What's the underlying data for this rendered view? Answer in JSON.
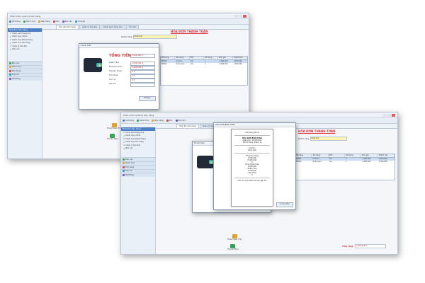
{
  "window1": {
    "title": "Phần mềm quản lý bán hàng",
    "menu": [
      "Hệ thống",
      "Danh mục",
      "Bán hàng",
      "Kho",
      "Báo cáo",
      "Trợ giúp"
    ],
    "tabs": [
      "Hóa đơn bán hàng",
      "Quản lý hóa đơn",
      "Danh sách hàng hóa",
      "Tồn kho"
    ],
    "sidebar_title": "Hóa đơn bán hàng",
    "sidebar_items": [
      "Danh sách hàng hóa",
      "Danh mục nhóm",
      "Danh mục khách hàng",
      "Danh mục kho hàng",
      "Quản lý hóa đơn",
      "Báo cáo"
    ],
    "sidebar_groups": [
      "Báo cáo",
      "Danh mục",
      "Kho hàng",
      "Tiện ích",
      "Hệ thống"
    ],
    "invoice_title": "HÓA ĐƠN THANH TOÁN",
    "customer_label": "Khách hàng",
    "customer_value": "Khách lẻ",
    "grid_headers": [
      "Mã hàng",
      "Tên hàng",
      "ĐVT",
      "Số lượng",
      "Đơn giá",
      "Thành tiền"
    ],
    "grid_rows": [
      [
        "SP001",
        "Áo thun",
        "Cái",
        "1",
        "1.000.000",
        "1.000.000"
      ],
      [
        "SP002",
        "Quần jean",
        "Cái",
        "1",
        "1.000.000",
        "1.000.000"
      ]
    ],
    "pay_dialog_title": "Thanh toán",
    "total_label": "TỔNG TIỀN:",
    "total_value": "2.000.000 đ",
    "pay_fields": [
      "Khách đưa",
      "Đã thanh toán",
      "Chuyển khoản",
      "Tiền thừa",
      "Còn nợ",
      "Ghi chú"
    ],
    "pay_values": [
      "2.000.000 đ",
      "2.000.000 đ",
      "0 đ",
      "0 đ",
      "0 đ",
      ""
    ],
    "pay_button": "Đồng ý",
    "actions": [
      "Thanh toán (F9)",
      "Hủy bỏ (Esc)"
    ]
  },
  "window2": {
    "title": "Phần mềm quản lý bán hàng",
    "invoice_title": "HÓA ĐƠN THANH TOÁN",
    "receipt_title": "HÓA ĐƠN BÁN HÀNG",
    "receipt_shop": "Cửa hàng bán lẻ",
    "receipt_lines": [
      "Ngày bán: 10/10/2024",
      "Khách hàng: Khách lẻ",
      "Tổng tiền hàng",
      "Chiết khấu",
      "Tổng thanh toán",
      "Khách đưa",
      "Tiền thừa"
    ],
    "receipt_values": [
      "",
      "",
      "2.000.000",
      "0",
      "2.000.000",
      "2.000.000",
      "0"
    ],
    "receipt_footer": "Cảm ơn quý khách và hẹn gặp lại!",
    "total_label": "Tổng cộng:",
    "total_value": "2.000.000 đ",
    "actions": [
      "Thanh toán (F9)",
      "Hủy bỏ (Esc)"
    ],
    "print_button": "In hóa đơn"
  },
  "colors": {
    "accent": "#4d7fc4",
    "red": "#e0313b"
  }
}
